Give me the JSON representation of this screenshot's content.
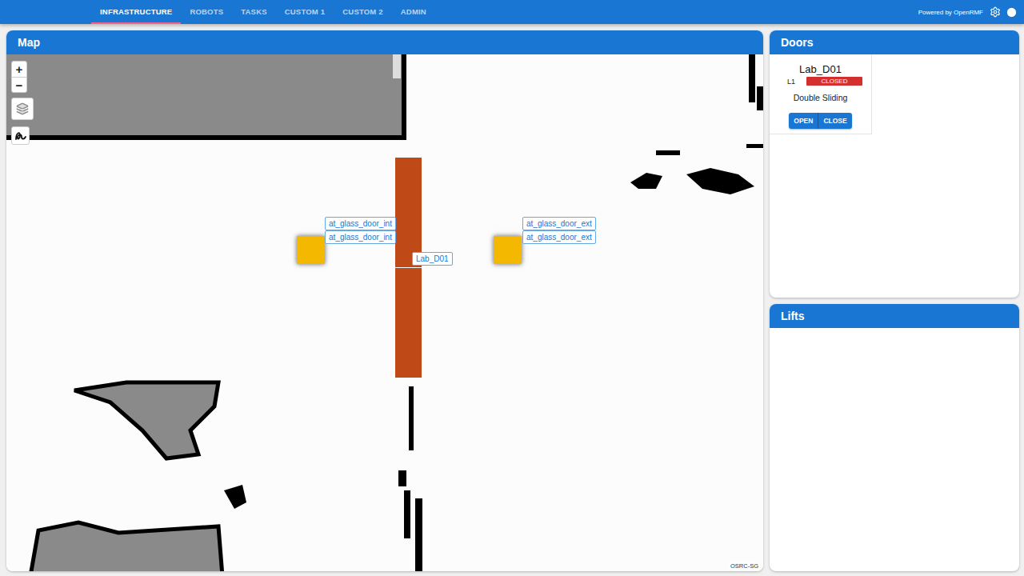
{
  "app_bar": {
    "tabs": [
      {
        "label": "INFRASTRUCTURE",
        "selected": true
      },
      {
        "label": "ROBOTS",
        "selected": false
      },
      {
        "label": "TASKS",
        "selected": false
      },
      {
        "label": "CUSTOM 1",
        "selected": false
      },
      {
        "label": "CUSTOM 2",
        "selected": false
      },
      {
        "label": "ADMIN",
        "selected": false
      }
    ],
    "powered_by": "Powered by OpenRMF"
  },
  "map": {
    "title": "Map",
    "zoom_in": "+",
    "zoom_out": "−",
    "attribution": "OSRC-SG",
    "places": [
      {
        "labels": [
          "at_glass_door_int",
          "at_glass_door_int"
        ]
      },
      {
        "labels": [
          "at_glass_door_ext",
          "at_glass_door_ext"
        ]
      }
    ],
    "doors": [
      {
        "label": "Lab_D01",
        "open": false
      }
    ]
  },
  "doors_panel": {
    "title": "Doors",
    "doors": [
      {
        "name": "Lab_D01",
        "level": "L1",
        "state": "CLOSED",
        "type": "Double Sliding",
        "buttons": [
          "OPEN",
          "CLOSE"
        ]
      }
    ]
  },
  "lifts_panel": {
    "title": "Lifts",
    "lifts": []
  }
}
